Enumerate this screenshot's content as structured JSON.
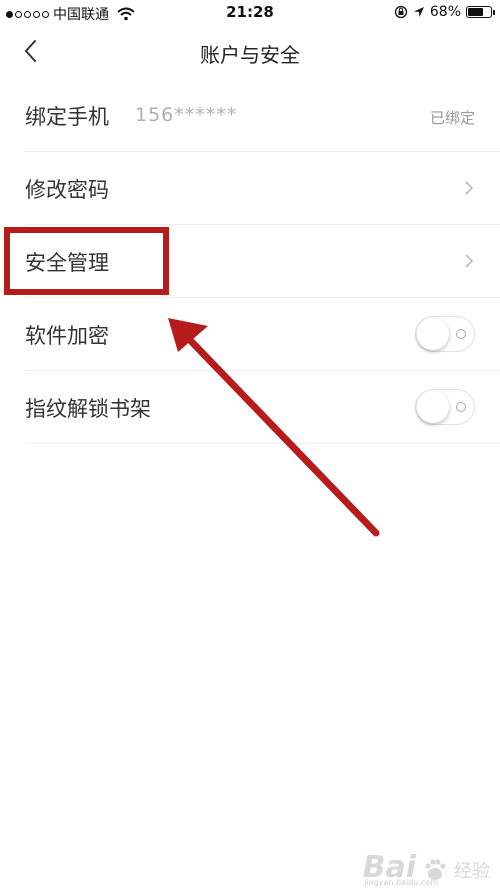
{
  "status_bar": {
    "carrier": "中国联通",
    "time": "21:28",
    "battery": "68%",
    "battery_level": 0.68
  },
  "nav": {
    "title": "账户与安全",
    "back_icon": "chevron-left-icon"
  },
  "rows": [
    {
      "label": "绑定手机",
      "phone": "156******",
      "status": "已绑定"
    },
    {
      "label": "修改密码",
      "icon": "chevron-right-icon"
    },
    {
      "label": "安全管理",
      "icon": "chevron-right-icon"
    },
    {
      "label": "软件加密",
      "toggle": false
    },
    {
      "label": "指纹解锁书架",
      "toggle": false
    }
  ],
  "annotation": {
    "color": "#b71c1c"
  },
  "watermark": {
    "logo": "Bai",
    "sub": "经验",
    "url": "jingyan.baidu.com"
  }
}
